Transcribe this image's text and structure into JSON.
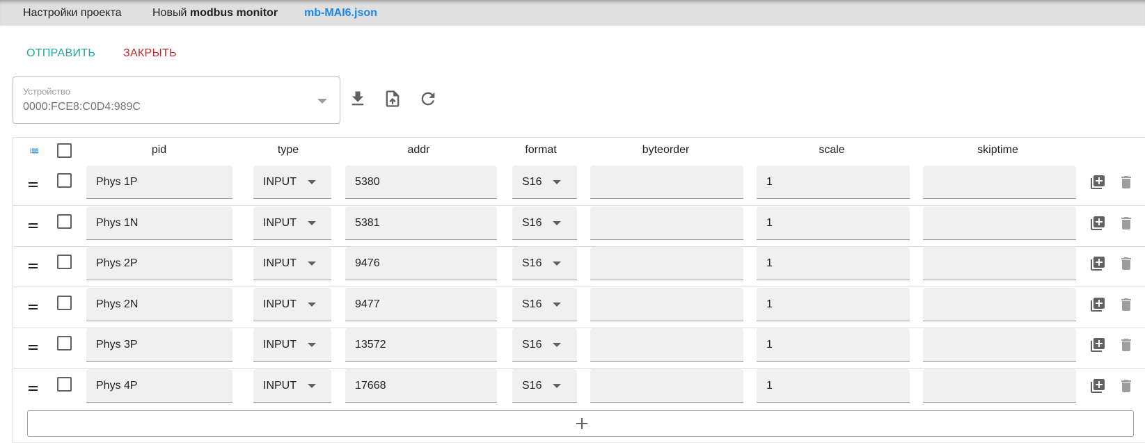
{
  "tabs": {
    "settings": "Настройки проекта",
    "new_prefix": "Новый",
    "new_name": "modbus monitor",
    "file": "mb-MAI6.json"
  },
  "actions": {
    "send": "ОТПРАВИТЬ",
    "close": "ЗАКРЫТЬ"
  },
  "device": {
    "label": "Устройство",
    "value": "0000:FCE8:C0D4:989C"
  },
  "toolbar_icons": [
    "download-icon",
    "upload-file-icon",
    "refresh-icon"
  ],
  "table": {
    "columns": [
      "pid",
      "type",
      "addr",
      "format",
      "byteorder",
      "scale",
      "skiptime"
    ],
    "rows": [
      {
        "pid": "Phys 1P",
        "type": "INPUT",
        "addr": "5380",
        "format": "S16",
        "byteorder": "",
        "scale": "1",
        "skiptime": ""
      },
      {
        "pid": "Phys 1N",
        "type": "INPUT",
        "addr": "5381",
        "format": "S16",
        "byteorder": "",
        "scale": "1",
        "skiptime": ""
      },
      {
        "pid": "Phys 2P",
        "type": "INPUT",
        "addr": "9476",
        "format": "S16",
        "byteorder": "",
        "scale": "1",
        "skiptime": ""
      },
      {
        "pid": "Phys 2N",
        "type": "INPUT",
        "addr": "9477",
        "format": "S16",
        "byteorder": "",
        "scale": "1",
        "skiptime": ""
      },
      {
        "pid": "Phys 3P",
        "type": "INPUT",
        "addr": "13572",
        "format": "S16",
        "byteorder": "",
        "scale": "1",
        "skiptime": ""
      },
      {
        "pid": "Phys 4P",
        "type": "INPUT",
        "addr": "17668",
        "format": "S16",
        "byteorder": "",
        "scale": "1",
        "skiptime": ""
      }
    ]
  },
  "colors": {
    "send": "#26a69a",
    "close": "#c62828",
    "file_tab": "#1e88e5",
    "list_icon": "#1e88e5",
    "icon": "#616161"
  }
}
